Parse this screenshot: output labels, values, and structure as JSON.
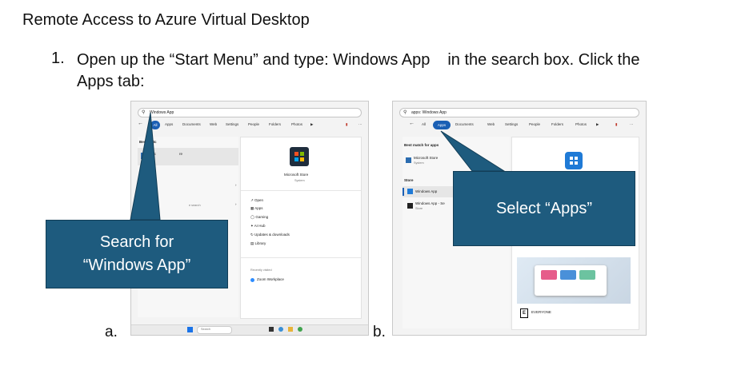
{
  "title": "Remote Access to Azure Virtual Desktop",
  "step": {
    "number": "1.",
    "line1a": "Open up the “Start Menu” and type: Windows App",
    "line1b": "in the search box.  Click the",
    "line2": "Apps tab:"
  },
  "labels": {
    "a": "a.",
    "b": "b."
  },
  "callouts": {
    "left": "Search for “Windows App”",
    "right": "Select “Apps”"
  },
  "shot_a": {
    "search_text": "Windows App",
    "tabs": [
      "All",
      "Apps",
      "Documents",
      "Web",
      "Settings",
      "People",
      "Folders",
      "Photos"
    ],
    "best_match": "Best matc",
    "best_item": "Mic",
    "best_item_tail": "re",
    "settings": "Setting",
    "search_hdr": "Searc",
    "search_web": "e search",
    "app_name": "Microsoft Store",
    "app_type": "System",
    "actions": [
      "Open",
      "Apps",
      "Gaming",
      "AI Hub",
      "Updates & downloads",
      "Library"
    ],
    "recent_hdr": "Recently visited",
    "recent_item": "Zoom Workplace",
    "taskbar_search": "Search"
  },
  "shot_b": {
    "search_text": "apps: Windows App",
    "tabs": [
      "All",
      "Apps",
      "Documents",
      "Web",
      "Settings",
      "People",
      "Folders",
      "Photos"
    ],
    "best_match": "Best match for apps",
    "best_item": "Microsoft Store",
    "best_item_sub": "System",
    "store_hdr": "Store",
    "store_item1": "Windows App",
    "store_item2": "Windows App - Se",
    "store_item2_sub": "Store",
    "rating": "EVERYONE"
  },
  "colors": {
    "callout": "#1e5b7e",
    "accent": "#1a5fb4"
  }
}
